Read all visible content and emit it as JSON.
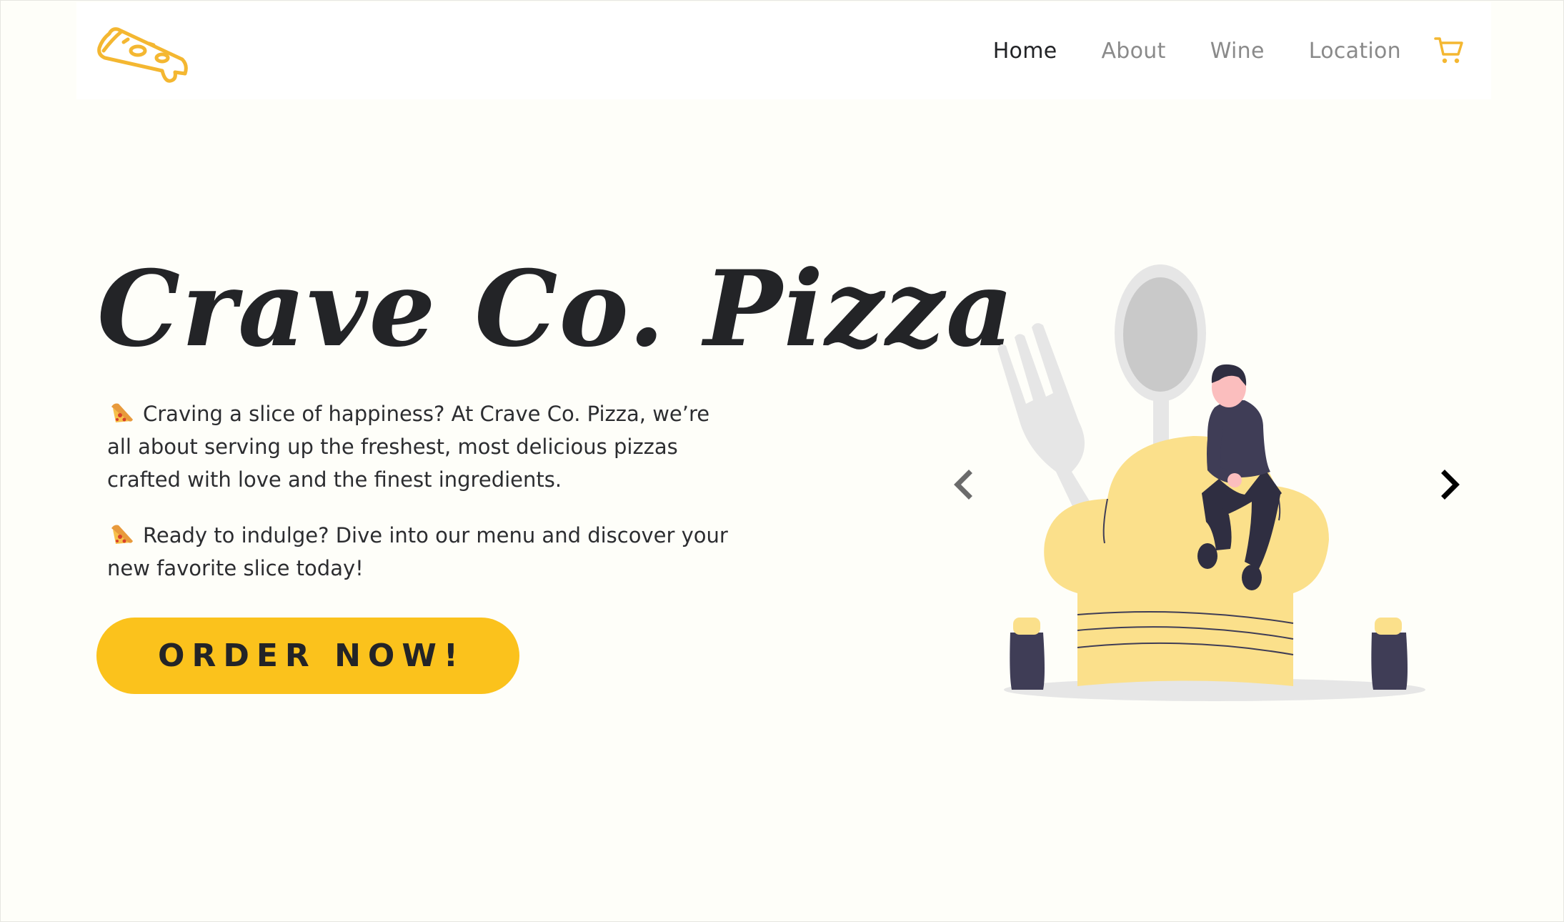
{
  "nav": {
    "logo_name": "pizza-slice-logo",
    "links": [
      {
        "label": "Home",
        "active": true
      },
      {
        "label": "About",
        "active": false
      },
      {
        "label": "Wine",
        "active": false
      },
      {
        "label": "Location",
        "active": false
      }
    ],
    "cart_icon": "shopping-cart-icon"
  },
  "hero": {
    "title": "Crave Co. Pizza",
    "paragraph1": "Craving a slice of happiness? At Crave Co. Pizza, we’re all about serving up the freshest, most delicious pizzas crafted with love and the finest ingredients.",
    "paragraph2": "Ready to indulge? Dive into our menu and discover your new favorite slice today!",
    "emoji_icon": "pizza-emoji-icon",
    "cta_label": "ORDER NOW!"
  },
  "carousel": {
    "prev_icon": "chevron-left-icon",
    "next_icon": "chevron-right-icon",
    "illustration": "chef-hat-illustration"
  },
  "colors": {
    "accent": "#fbc21c",
    "logo": "#f4b731",
    "text_dark": "#222326",
    "text_muted": "#8a8a8a",
    "background": "#fefef9",
    "hat": "#fbe08b",
    "figure": "#3f3d56"
  }
}
